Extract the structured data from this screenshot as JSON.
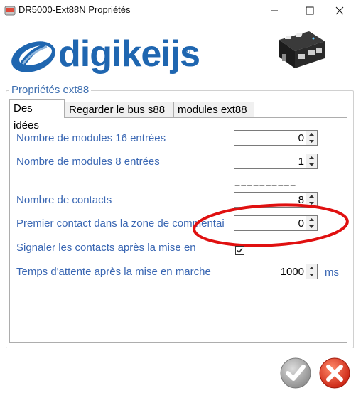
{
  "window": {
    "title": "DR5000-Ext88N Propriétés",
    "minimize_icon": "minimize-icon",
    "maximize_icon": "maximize-icon",
    "close_icon": "close-icon"
  },
  "header": {
    "logo_text": "digikeijs",
    "logo_reg": "®"
  },
  "group": {
    "title": "Propriétés ext88"
  },
  "tabs": [
    {
      "label": "Des idées",
      "active": true
    },
    {
      "label": "Regarder le bus s88",
      "active": false
    },
    {
      "label": "modules ext88",
      "active": false
    }
  ],
  "fields": {
    "modules16": {
      "label": "Nombre de modules 16 entrées",
      "value": "0"
    },
    "modules8": {
      "label": "Nombre de modules 8 entrées",
      "value": "1"
    },
    "separator": "==========",
    "contacts": {
      "label": "Nombre de contacts",
      "value": "8"
    },
    "premier": {
      "label": "Premier contact dans la zone de commentai",
      "value": "0"
    },
    "signaler": {
      "label": "Signaler les contacts après la mise en",
      "checked": true
    },
    "temps": {
      "label": "Temps d'attente après la mise en marche",
      "value": "1000",
      "unit": "ms"
    }
  },
  "colors": {
    "label_blue": "#3a67b3",
    "logo_blue": "#1f66b0",
    "highlight_red": "#e01010",
    "ok_gray": "#9a9a9a",
    "cancel_red": "#d9301a"
  }
}
